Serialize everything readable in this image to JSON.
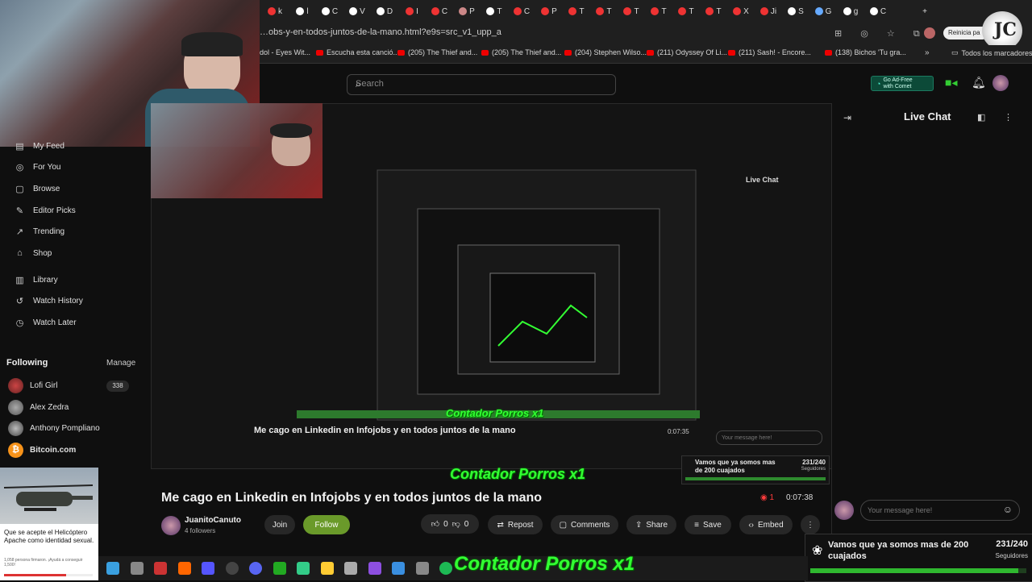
{
  "browser": {
    "url": "…obs-y-en-todos-juntos-de-la-mano.html?e9s=src_v1_upp_a",
    "profile_label": "Reinicia pa",
    "bookmarks": [
      {
        "label": "dol - Eyes Wit..."
      },
      {
        "label": "Escucha esta canció..."
      },
      {
        "label": "(205) The Thief and..."
      },
      {
        "label": "(205) The Thief and..."
      },
      {
        "label": "(204) Stephen Wilso..."
      },
      {
        "label": "(211) Odyssey Of Li..."
      },
      {
        "label": "(211) Sash! - Encore..."
      },
      {
        "label": "(138) Bichos 'Tu gra..."
      }
    ],
    "all_bookmarks": "Todos los marcadores",
    "tab_letters": [
      "k",
      "l",
      "C",
      "V",
      "D",
      "I",
      "C",
      "P",
      "T",
      "C",
      "P",
      "T",
      "T",
      "T",
      "T",
      "T",
      "T",
      "X",
      "Ji",
      "S",
      "G",
      "g",
      "C"
    ]
  },
  "header": {
    "search_placeholder": "Search",
    "adfree_line1": "Go Ad-Free",
    "adfree_line2": "with Comet"
  },
  "sidebar": {
    "nav": [
      "My Feed",
      "For You",
      "Browse",
      "Editor Picks",
      "Trending",
      "Shop",
      "Library",
      "Watch History",
      "Watch Later"
    ],
    "following_title": "Following",
    "manage": "Manage",
    "channels": [
      {
        "name": "Lofi Girl",
        "badge": "338"
      },
      {
        "name": "Alex Zedra",
        "badge": ""
      },
      {
        "name": "Anthony Pompliano",
        "badge": ""
      },
      {
        "name": "Bitcoin.com",
        "badge": ""
      }
    ]
  },
  "promo": {
    "text": "Que se acepte el Helicóptero Apache como identidad sexual.",
    "signed": "1,058 persona firmaron. ¡Ayudá a conseguir 1,500!",
    "progress": 0.7
  },
  "video": {
    "title": "Me cago en Linkedin en Infojobs y en todos juntos de la mano",
    "live_count": "1",
    "duration": "0:07:38",
    "channel": "JuanitoCanuto",
    "followers": "4 followers",
    "join": "Join",
    "follow": "Follow",
    "likes": "0",
    "dislikes": "0",
    "repost": "Repost",
    "comments": "Comments",
    "share": "Share",
    "save": "Save",
    "embed": "Embed"
  },
  "chat": {
    "title": "Live Chat",
    "placeholder": "Your message here!"
  },
  "overlay": {
    "counter_text": "Contador Porros x1",
    "goal_text": "Vamos que ya somos mas de 200 cuajados",
    "goal_value": "231/240",
    "goal_label": "Seguidores",
    "goal_progress": 0.9625
  },
  "nested": {
    "title": "Me cago en Linkedin en Infojobs y en todos juntos de la mano",
    "duration": "0:07:35",
    "goal_text": "Vamos que ya somos mas de 200 cuajados",
    "goal_value": "231/240",
    "goal_label": "Seguidores",
    "chat_title": "Live Chat",
    "chat_placeholder": "Your message here!"
  },
  "colors": {
    "accent_green": "#33ff33",
    "follow_green": "#6a9a2a",
    "live_red": "#ff3b3b"
  }
}
